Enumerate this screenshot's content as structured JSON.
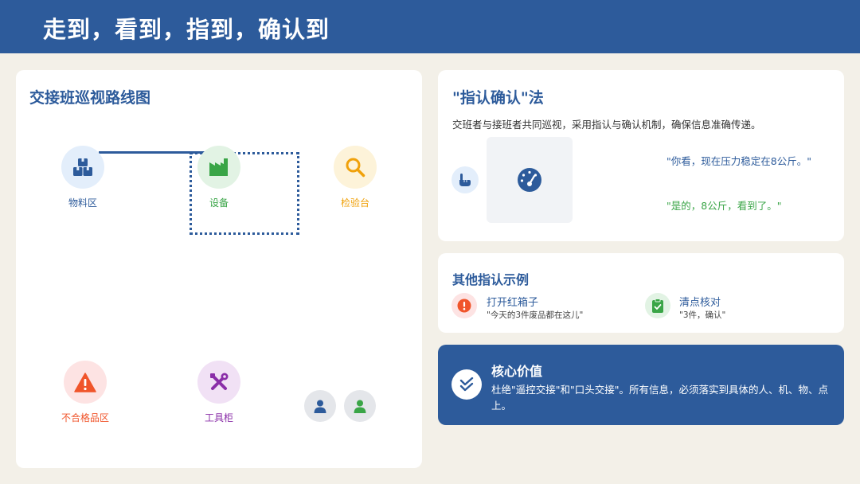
{
  "header": {
    "title": "走到，看到，指到，确认到"
  },
  "route_map": {
    "title": "交接班巡视路线图",
    "nodes": [
      {
        "label": "物料区",
        "icon": "boxes-icon",
        "color": "#2d5b9b",
        "bg": "#e3eefb"
      },
      {
        "label": "设备",
        "icon": "factory-icon",
        "color": "#3aa547",
        "bg": "#e2f3e4"
      },
      {
        "label": "检验台",
        "icon": "search-icon",
        "color": "#f0a10a",
        "bg": "#fdf3d9"
      },
      {
        "label": "不合格品区",
        "icon": "warning-icon",
        "color": "#f0552b",
        "bg": "#fde3e3"
      },
      {
        "label": "工具柜",
        "icon": "tools-icon",
        "color": "#8a2ea8",
        "bg": "#f1e1f5"
      }
    ],
    "people": [
      {
        "icon": "person-icon",
        "color": "#2d5b9b"
      },
      {
        "icon": "person-icon",
        "color": "#3aa547"
      }
    ]
  },
  "method": {
    "title": "\"指认确认\"法",
    "description": "交班者与接班者共同巡视，采用指认与确认机制，确保信息准确传递。",
    "quote_1": "\"你看，现在压力稳定在8公斤。\"",
    "quote_2": "\"是的，8公斤，看到了。\"",
    "icons": {
      "hand": "pointing-hand-icon",
      "gauge": "gauge-icon"
    }
  },
  "examples": {
    "title": "其他指认示例",
    "items": [
      {
        "title": "打开红箱子",
        "subtitle": "\"今天的3件废品都在这儿\"",
        "icon": "exclamation-icon",
        "color": "#f0552b",
        "bg": "#fde3e3"
      },
      {
        "title": "清点核对",
        "subtitle": "\"3件，确认\"",
        "icon": "clipboard-check-icon",
        "color": "#3aa547",
        "bg": "#e2f3e4"
      }
    ]
  },
  "core": {
    "title": "核心价值",
    "description": "杜绝\"遥控交接\"和\"口头交接\"。所有信息，必须落实到具体的人、机、物、点上。",
    "icon": "double-check-icon"
  }
}
